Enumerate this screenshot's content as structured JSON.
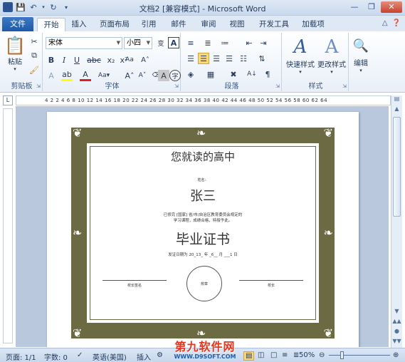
{
  "window": {
    "title": "文档2 [兼容模式] - Microsoft Word",
    "minimize_icon": "minimize-icon",
    "restore_icon": "restore-icon",
    "close_icon": "close-icon"
  },
  "qat": {
    "logo": "W",
    "save_icon": "save-icon",
    "undo_icon": "undo-icon",
    "redo_icon": "redo-icon"
  },
  "tabs": {
    "file": "文件",
    "items": [
      "开始",
      "插入",
      "页面布局",
      "引用",
      "邮件",
      "审阅",
      "视图",
      "开发工具",
      "加载项"
    ],
    "active": "开始"
  },
  "ribbon": {
    "clipboard": {
      "label": "剪贴板",
      "paste": "粘贴"
    },
    "font": {
      "label": "字体",
      "font_name": "宋体",
      "font_size": "小四"
    },
    "paragraph": {
      "label": "段落"
    },
    "styles": {
      "label": "样式",
      "quick_styles": "快速样式",
      "change_styles": "更改样式"
    },
    "editing": {
      "label": "编辑"
    }
  },
  "ruler": {
    "ticks": "4 2 2 4 6 8 10 12 14 16 18 20 22 24 26 28 30 32 34 36 38 40 42 44 46 48 50 52 54 56 58 60 62 64"
  },
  "certificate": {
    "school_heading": "您就读的高中",
    "student_label": "姓名：",
    "student_name": "张三",
    "body_line1": "已修完 [国家] 省/市/自治区教育委员会规定的",
    "body_line2": "学习课程，成绩合格，特授予此。",
    "main_title": "毕业证书",
    "date_line": "发证日期为 20_13_ 年 _6__ 月 ___1 日",
    "left_signature": "校长签名",
    "seal": "校章",
    "right_signature": "校长"
  },
  "statusbar": {
    "page": "页面: 1/1",
    "words": "字数: 0",
    "language": "英语(美国)",
    "insert_mode": "插入",
    "zoom": "50%"
  },
  "watermark": {
    "brand": "第九软件网",
    "url": "WWW.D9SOFT.COM"
  }
}
